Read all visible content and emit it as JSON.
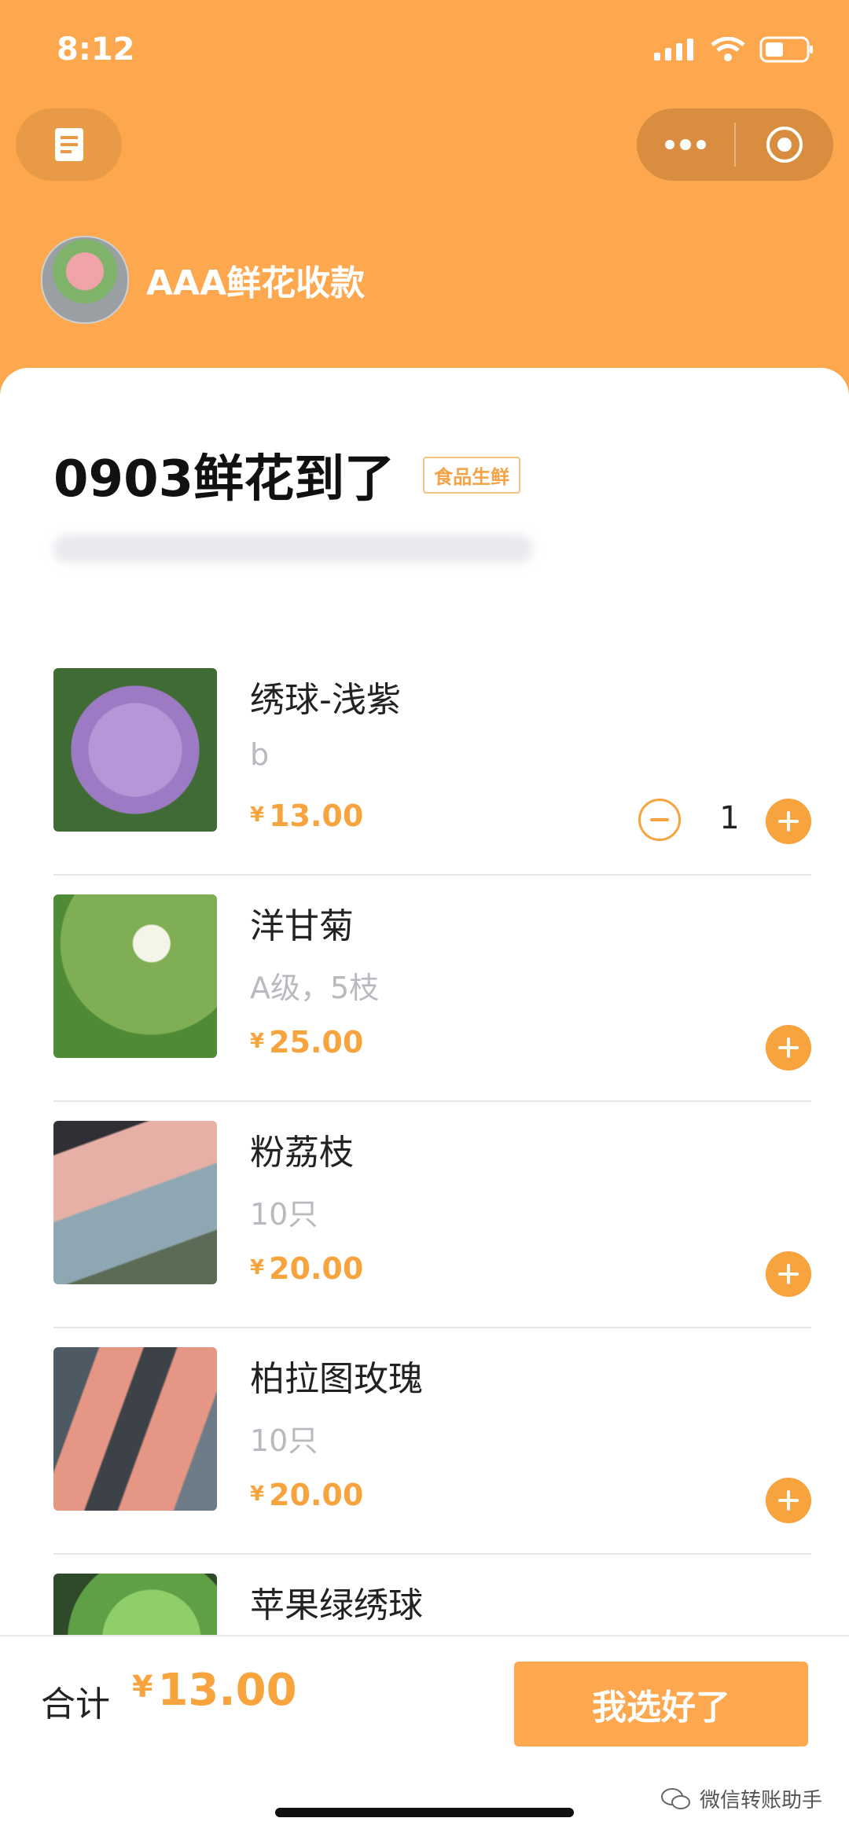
{
  "status": {
    "time": "8:12"
  },
  "shop": {
    "name": "AAA鲜花收款"
  },
  "page": {
    "title": "0903鲜花到了",
    "tag": "食品生鲜"
  },
  "currency": "¥",
  "items": [
    {
      "name": "绣球-浅紫",
      "desc": "b",
      "price": "13.00",
      "qty": "1"
    },
    {
      "name": "洋甘菊",
      "desc": "A级，5枝",
      "price": "25.00"
    },
    {
      "name": "粉荔枝",
      "desc": "10只",
      "price": "20.00"
    },
    {
      "name": "柏拉图玫瑰",
      "desc": "10只",
      "price": "20.00"
    },
    {
      "name": "苹果绿绣球"
    }
  ],
  "footer": {
    "total_label": "合计",
    "total_value": "13.00",
    "confirm_label": "我选好了"
  },
  "watermark": "微信转账助手",
  "colors": {
    "accent": "#fda84e",
    "price": "#f7a43f"
  }
}
